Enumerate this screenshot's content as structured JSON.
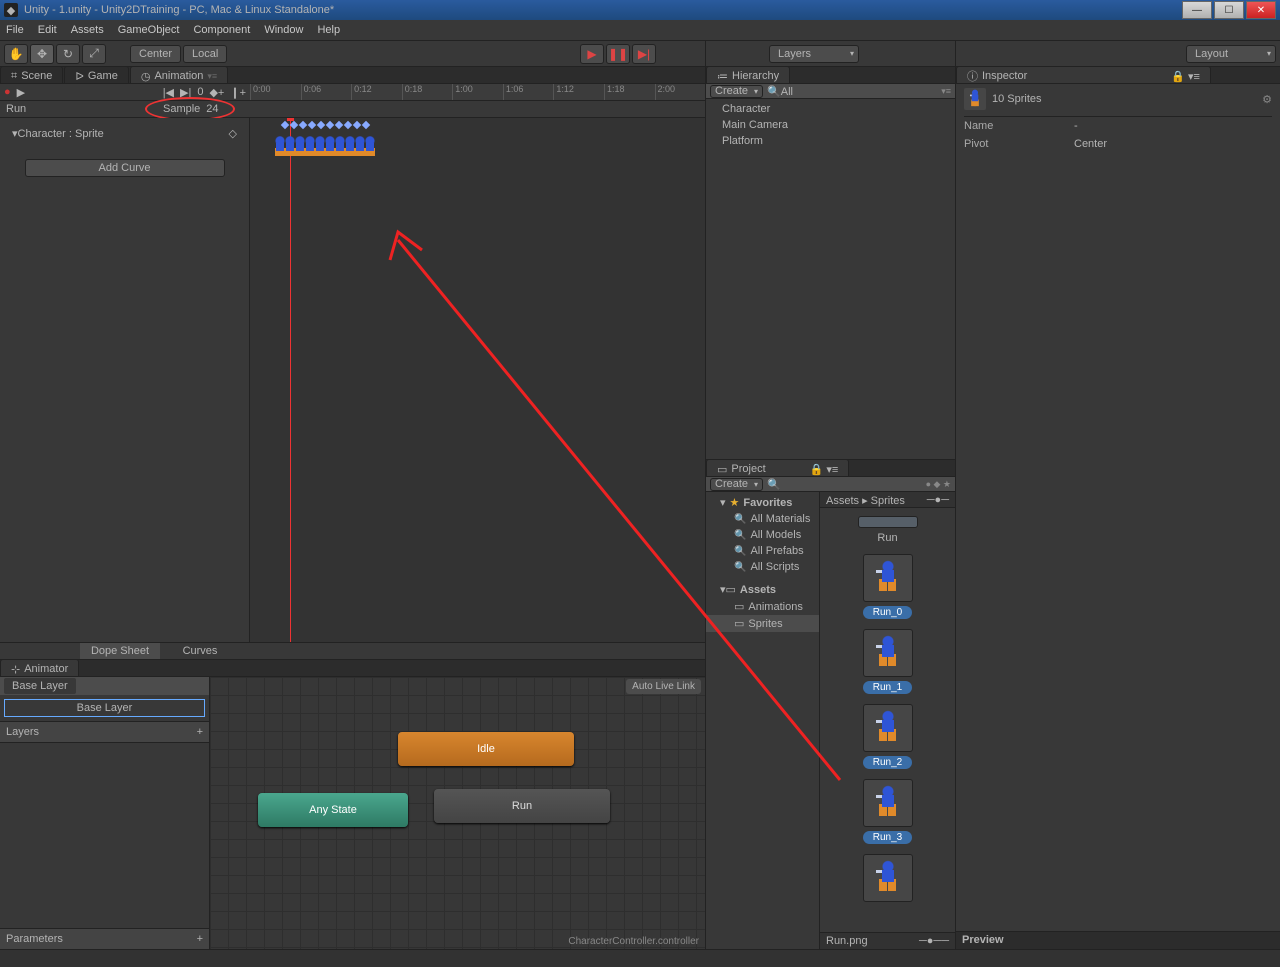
{
  "window": {
    "title": "Unity - 1.unity - Unity2DTraining - PC, Mac & Linux Standalone*"
  },
  "menu": [
    "File",
    "Edit",
    "Assets",
    "GameObject",
    "Component",
    "Window",
    "Help"
  ],
  "toolbar": {
    "center": "Center",
    "local": "Local",
    "layers": "Layers",
    "layout": "Layout"
  },
  "tabs": {
    "scene": "Scene",
    "game": "Game",
    "animation": "Animation"
  },
  "animation": {
    "frame": "0",
    "clip": "Run",
    "sample_label": "Sample",
    "sample_value": "24",
    "track": "Character : Sprite",
    "add_curve": "Add Curve",
    "ruler": [
      "0:00",
      "0:06",
      "0:12",
      "0:18",
      "1:00",
      "1:06",
      "1:12",
      "1:18",
      "2:00"
    ],
    "dope": "Dope Sheet",
    "curves": "Curves"
  },
  "animator": {
    "tab": "Animator",
    "base_layer_crumb": "Base Layer",
    "base_layer_btn": "Base Layer",
    "layers": "Layers",
    "parameters": "Parameters",
    "autolive": "Auto Live Link",
    "states": {
      "idle": "Idle",
      "anystate": "Any State",
      "run": "Run"
    },
    "footer": "CharacterController.controller"
  },
  "hierarchy": {
    "title": "Hierarchy",
    "create": "Create",
    "search": "All",
    "items": [
      "Character",
      "Main Camera",
      "Platform"
    ]
  },
  "project": {
    "title": "Project",
    "create": "Create",
    "favorites": "Favorites",
    "fav_items": [
      "All Materials",
      "All Models",
      "All Prefabs",
      "All Scripts"
    ],
    "assets": "Assets",
    "asset_items": [
      "Animations",
      "Sprites"
    ],
    "breadcrumb": "Assets ▸ Sprites",
    "run_folder": "Run",
    "sprites": [
      "Run_0",
      "Run_1",
      "Run_2",
      "Run_3"
    ],
    "footer": "Run.png",
    "preview": "Preview"
  },
  "inspector": {
    "title": "Inspector",
    "heading": "10 Sprites",
    "name_k": "Name",
    "name_v": "-",
    "pivot_k": "Pivot",
    "pivot_v": "Center"
  }
}
